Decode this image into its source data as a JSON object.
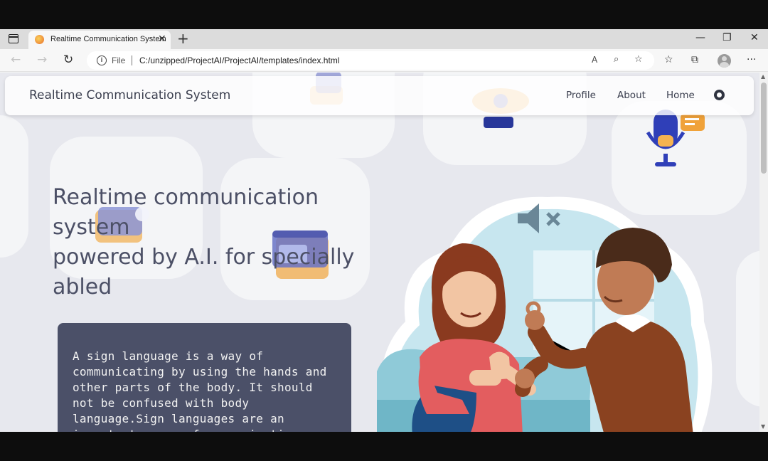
{
  "browser": {
    "tab_title": "Realtime Communication System",
    "new_tab_symbol": "+",
    "close_tab_symbol": "✕",
    "address_scheme_label": "File",
    "address_url": "C:/unzipped/ProjectAI/ProjectAI/templates/index.html",
    "icons": [
      "tab-actions-icon",
      "back-icon",
      "forward-icon",
      "reload-icon",
      "info-icon",
      "read-aloud-icon",
      "zoom-icon",
      "favorite-add-icon",
      "favorites-icon",
      "collections-icon",
      "profile-avatar",
      "more-icon",
      "minimize-icon",
      "restore-icon",
      "close-window-icon"
    ]
  },
  "page": {
    "brand": "Realtime Communication System",
    "nav": {
      "profile": "Profile",
      "about": "About",
      "home": "Home",
      "github_icon": "github-icon"
    },
    "hero": {
      "line1": "Realtime communication system",
      "line2": "powered by A.I. for specially abled"
    },
    "card_text": "A sign language is a way of communicating by using the hands and other parts of the body. It should not be confused with body language.Sign languages are an important means of communication",
    "colors": {
      "card_bg": "#4b5068",
      "heading": "#4c5066",
      "page_bg": "#e7e8ee"
    }
  }
}
